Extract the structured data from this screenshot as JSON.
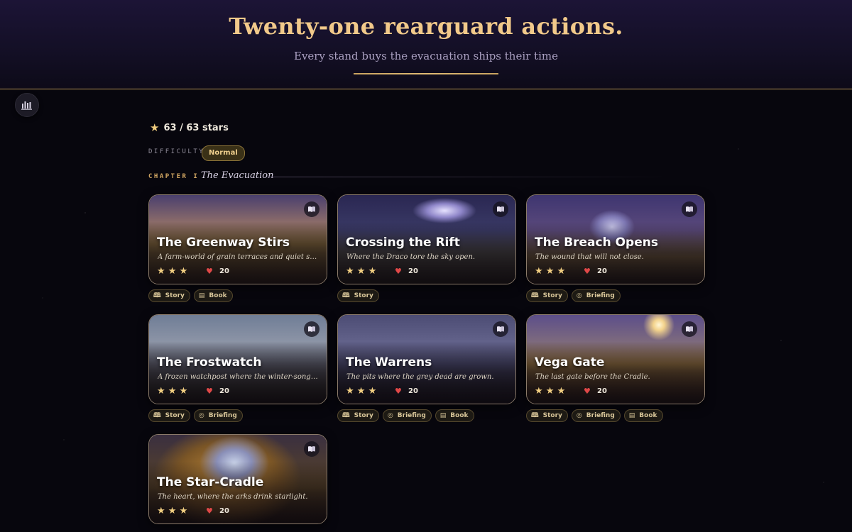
{
  "header": {
    "title": "Twenty-one rearguard actions.",
    "subtitle": "Every stand buys the evacuation ships their time"
  },
  "stats_button": {
    "icon": "bar-chart-icon"
  },
  "progress": {
    "star_icon": "star-icon",
    "text": "63 / 63 stars"
  },
  "difficulty": {
    "label": "DIFFICULTY",
    "value": "Normal"
  },
  "chapter": {
    "label": "CHAPTER I",
    "title": "The Evacuation"
  },
  "cards": [
    {
      "title": "The Greenway Stirs",
      "desc": "A farm-world of grain terraces and quiet song.",
      "stars": "★ ★ ★",
      "stars_count": 3,
      "hp": "20",
      "lore_icon": "book-icon",
      "tags": [
        "Story",
        "Book"
      ]
    },
    {
      "title": "Crossing the Rift",
      "desc": "Where the Draco tore the sky open.",
      "stars": "★ ★ ★",
      "stars_count": 3,
      "hp": "20",
      "lore_icon": "book-icon",
      "tags": [
        "Story"
      ]
    },
    {
      "title": "The Breach Opens",
      "desc": "The wound that will not close.",
      "stars": "★ ★ ★",
      "stars_count": 3,
      "hp": "20",
      "lore_icon": "book-icon",
      "tags": [
        "Story",
        "Briefing"
      ]
    },
    {
      "title": "The Frostwatch",
      "desc": "A frozen watchpost where the winter-song deepe...",
      "stars": "★ ★ ★",
      "stars_count": 3,
      "hp": "20",
      "lore_icon": "book-icon",
      "tags": [
        "Story",
        "Briefing"
      ]
    },
    {
      "title": "The Warrens",
      "desc": "The pits where the grey dead are grown.",
      "stars": "★ ★ ★",
      "stars_count": 3,
      "hp": "20",
      "lore_icon": "book-icon",
      "tags": [
        "Story",
        "Briefing",
        "Book"
      ]
    },
    {
      "title": "Vega Gate",
      "desc": "The last gate before the Cradle.",
      "stars": "★ ★ ★",
      "stars_count": 3,
      "hp": "20",
      "lore_icon": "book-icon",
      "tags": [
        "Story",
        "Briefing",
        "Book"
      ]
    },
    {
      "title": "The Star-Cradle",
      "desc": "The heart, where the arks drink starlight.",
      "stars": "★ ★ ★",
      "stars_count": 3,
      "hp": "20",
      "lore_icon": "book-icon",
      "tags": []
    }
  ],
  "tag_icons": {
    "Story": "open-book-icon",
    "Book": "book-icon",
    "Briefing": "briefing-icon"
  },
  "colors": {
    "accent_gold": "#f1c98a",
    "star": "#f2cf82",
    "heart": "#e04848",
    "background": "#07060d"
  }
}
